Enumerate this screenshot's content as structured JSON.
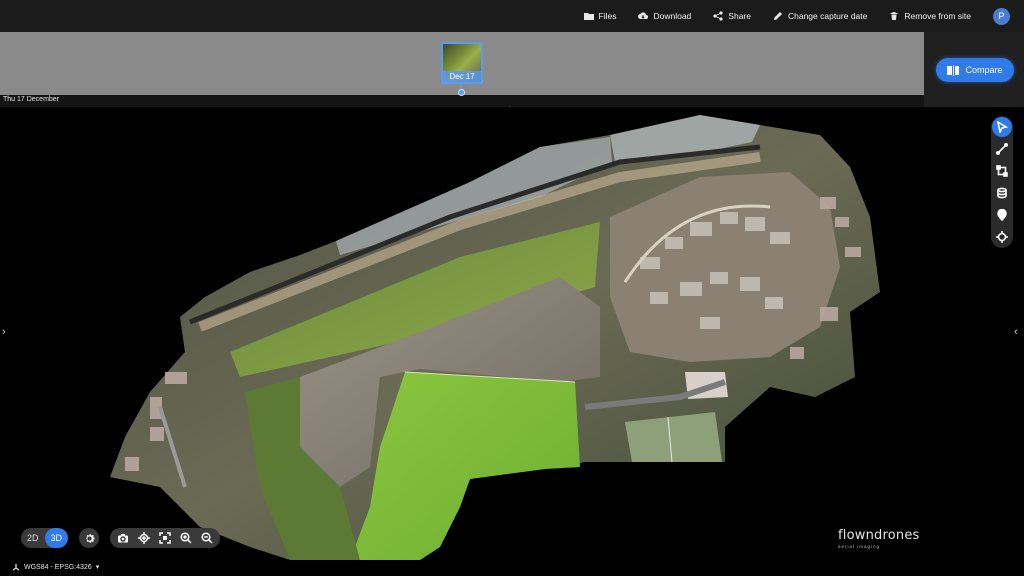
{
  "header": {
    "actions": [
      {
        "label": "Files",
        "icon": "folder-icon"
      },
      {
        "label": "Download",
        "icon": "cloud-download-icon"
      },
      {
        "label": "Share",
        "icon": "share-icon"
      },
      {
        "label": "Change capture date",
        "icon": "pencil-icon"
      },
      {
        "label": "Remove from site",
        "icon": "trash-icon"
      }
    ],
    "avatar_initial": "P"
  },
  "timeline": {
    "selected_date_full": "Thu 17 December",
    "thumbnail_label": "Dec 17",
    "compare_label": "Compare"
  },
  "map_controls": {
    "mode_2d": "2D",
    "mode_3d": "3D",
    "active_mode": "3D",
    "crs_label": "WGS84 - EPSG:4326"
  },
  "toolbar": {
    "tools": [
      "select-pointer-icon",
      "measure-line-icon",
      "measure-area-icon",
      "volume-icon",
      "location-pin-icon",
      "crosshair-icon"
    ],
    "active_tool": "select-pointer-icon"
  },
  "view_tools": [
    "camera-icon",
    "locate-icon",
    "fit-extent-icon",
    "zoom-in-icon",
    "zoom-out-icon"
  ],
  "branding": {
    "logo": "flowndrones",
    "tagline": "aerial imaging"
  },
  "colors": {
    "accent": "#2f7bea",
    "topbar": "#1b1b1b",
    "timeline": "#8a8a8a",
    "pitch_green": "#7cc03a"
  }
}
